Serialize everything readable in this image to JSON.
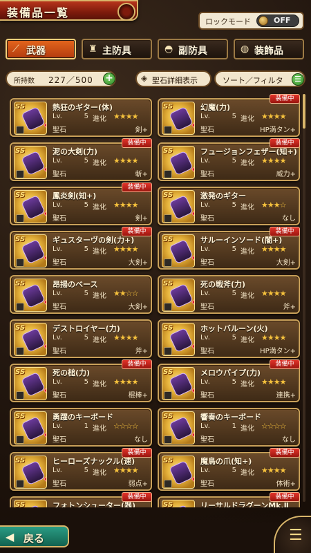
{
  "header": {
    "title": "装備品一覧"
  },
  "lock_mode": {
    "label": "ロックモード",
    "state": "OFF"
  },
  "tabs": [
    {
      "label": "武器",
      "icon": "sword-icon",
      "active": true
    },
    {
      "label": "主防具",
      "icon": "armor-icon",
      "active": false
    },
    {
      "label": "副防具",
      "icon": "helmet-icon",
      "active": false
    },
    {
      "label": "装飾品",
      "icon": "necklace-icon",
      "active": false
    }
  ],
  "inventory": {
    "label": "所持数",
    "value": "227／500"
  },
  "detail_button": {
    "label": "聖石詳細表示"
  },
  "sort_button": {
    "label": "ソート／フィルタ"
  },
  "items": [
    {
      "name": "熱狂のギター(体)",
      "lv": "5",
      "stars": "★★★★",
      "stone": "剣+",
      "equipped": false
    },
    {
      "name": "幻魔(力)",
      "lv": "5",
      "stars": "★★★★",
      "stone": "HP満タン+",
      "equipped": true
    },
    {
      "name": "泥の大剣(力)",
      "lv": "5",
      "stars": "★★★★",
      "stone": "斬+",
      "equipped": true
    },
    {
      "name": "フュージョンフェザー(知+)",
      "lv": "5",
      "stars": "★★★★",
      "stone": "威力+",
      "equipped": true
    },
    {
      "name": "鳳炎剣(知+)",
      "lv": "5",
      "stars": "★★★★",
      "stone": "剣+",
      "equipped": true
    },
    {
      "name": "激発のギター",
      "lv": "5",
      "stars": "★★★☆",
      "stone": "なし",
      "equipped": false
    },
    {
      "name": "ギュスターヴの剣(力+)",
      "lv": "5",
      "stars": "★★★★",
      "stone": "大剣+",
      "equipped": true
    },
    {
      "name": "サルーインソード(闇+)",
      "lv": "5",
      "stars": "★★★★",
      "stone": "大剣+",
      "equipped": true
    },
    {
      "name": "昂揚のベース",
      "lv": "5",
      "stars": "★★☆☆",
      "stone": "大剣+",
      "equipped": false
    },
    {
      "name": "死の戦斧(力)",
      "lv": "5",
      "stars": "★★★★",
      "stone": "斧+",
      "equipped": false
    },
    {
      "name": "デストロイヤー(力)",
      "lv": "5",
      "stars": "★★★★",
      "stone": "斧+",
      "equipped": false
    },
    {
      "name": "ホットバルーン(火)",
      "lv": "5",
      "stars": "★★★★",
      "stone": "HP満タン+",
      "equipped": false
    },
    {
      "name": "死の槌(力)",
      "lv": "5",
      "stars": "★★★★",
      "stone": "棍棒+",
      "equipped": true
    },
    {
      "name": "メロウパイプ(力)",
      "lv": "5",
      "stars": "★★★★",
      "stone": "連携+",
      "equipped": true
    },
    {
      "name": "勇躍のキーボード",
      "lv": "1",
      "stars": "☆☆☆☆",
      "stone": "なし",
      "equipped": false
    },
    {
      "name": "響奏のキーボード",
      "lv": "1",
      "stars": "☆☆☆☆",
      "stone": "なし",
      "equipped": false
    },
    {
      "name": "ヒーローズナックル(速)",
      "lv": "5",
      "stars": "★★★★",
      "stone": "弱点+",
      "equipped": true
    },
    {
      "name": "魔鳥の爪(知+)",
      "lv": "5",
      "stars": "★★★★",
      "stone": "体術+",
      "equipped": true
    },
    {
      "name": "フォトンシューター(器)",
      "lv": "",
      "stars": "",
      "stone": "",
      "equipped": true
    },
    {
      "name": "リーサルドラグーンMk.Ⅱ",
      "lv": "",
      "stars": "",
      "stone": "",
      "equipped": true
    }
  ],
  "labels": {
    "lv": "Lv.",
    "evolution": "進化",
    "stone": "聖石",
    "equipped_badge": "装備中"
  },
  "footer": {
    "back_label": "戻る"
  }
}
